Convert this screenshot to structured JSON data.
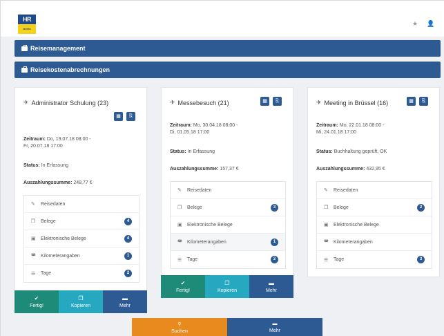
{
  "header": {
    "logo_top": "HR",
    "logo_bottom": "works",
    "star_icon": "★",
    "user_icon": "👤"
  },
  "nav": {
    "reisemanagement": "Reisemanagement",
    "reisekosten": "Reisekostenabrechnungen"
  },
  "cards": [
    {
      "title": "Administrator Schulung (23)",
      "zeitraum_label": "Zeitraum:",
      "zeitraum_value": "Do, 19.07.18 08:00 -",
      "zeitraum_value2": "Fr, 20.07.18 17:00",
      "status_label": "Status:",
      "status_value": "In Erfassung",
      "summe_label": "Auszahlungssumme:",
      "summe_value": "248,77 €",
      "rows": [
        {
          "label": "Reisedaten",
          "badge": ""
        },
        {
          "label": "Belege",
          "badge": "4"
        },
        {
          "label": "Elektronische Belege",
          "badge": "4"
        },
        {
          "label": "Kilometerangaben",
          "badge": "1"
        },
        {
          "label": "Tage",
          "badge": "2"
        }
      ]
    },
    {
      "title": "Messebesuch (21)",
      "zeitraum_label": "Zeitraum:",
      "zeitraum_value": "Mo, 30.04.18 08:00 -",
      "zeitraum_value2": "Di, 01.05.18 17:00",
      "status_label": "Status:",
      "status_value": "In Erfassung",
      "summe_label": "Auszahlungssumme:",
      "summe_value": "157,37 €",
      "rows": [
        {
          "label": "Reisedaten",
          "badge": ""
        },
        {
          "label": "Belege",
          "badge": "3"
        },
        {
          "label": "Elektronische Belege",
          "badge": ""
        },
        {
          "label": "Kilometerangaben",
          "badge": "1"
        },
        {
          "label": "Tage",
          "badge": "2"
        }
      ]
    },
    {
      "title": "Meeting in Brüssel (16)",
      "zeitraum_label": "Zeitraum:",
      "zeitraum_value": "Mo, 22.01.18 08:00 -",
      "zeitraum_value2": "Mi, 24.01.18 17:00",
      "status_label": "Status:",
      "status_value": "Buchhaltung geprüft, OK",
      "summe_label": "Auszahlungssumme:",
      "summe_value": "432,95 €",
      "rows": [
        {
          "label": "Reisedaten",
          "badge": ""
        },
        {
          "label": "Belege",
          "badge": "2"
        },
        {
          "label": "Elektronische Belege",
          "badge": ""
        },
        {
          "label": "Kilometerangaben",
          "badge": ""
        },
        {
          "label": "Tage",
          "badge": "3"
        }
      ]
    }
  ],
  "actions": {
    "fertig": "Fertig!",
    "kopieren": "Kopieren",
    "mehr": "Mehr"
  },
  "bottom": {
    "suchen": "Suchen",
    "mehr": "Mehr"
  },
  "colors": {
    "primary": "#2d5a92",
    "green": "#1e8a78",
    "teal": "#26a8c0",
    "orange": "#e98a1f"
  }
}
